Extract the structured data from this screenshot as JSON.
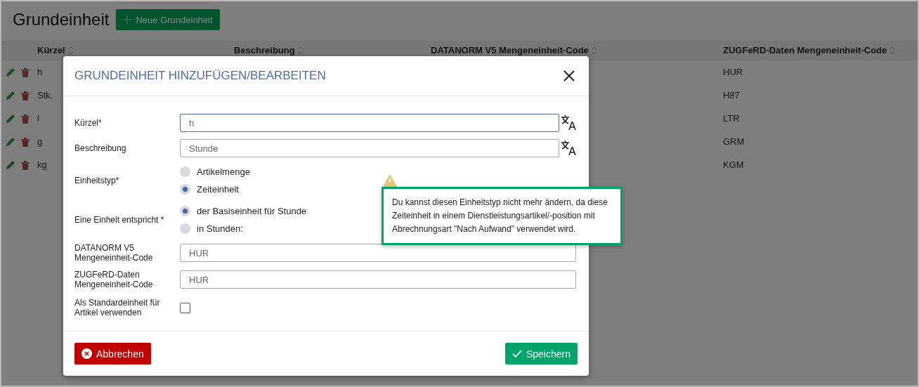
{
  "page": {
    "title": "Grundeinheit",
    "new_button": "Neue Grundeinheit"
  },
  "table": {
    "columns": [
      "Kürzel",
      "Beschreibung",
      "DATANORM V5 Mengeneinheit-Code",
      "ZUGFeRD-Daten Mengeneinheit-Code"
    ],
    "rows": [
      {
        "kuerzel": "h",
        "zugferd": "HUR"
      },
      {
        "kuerzel": "Stk.",
        "zugferd": "H87"
      },
      {
        "kuerzel": "l",
        "zugferd": "LTR"
      },
      {
        "kuerzel": "g",
        "zugferd": "GRM"
      },
      {
        "kuerzel": "kg",
        "zugferd": "KGM"
      }
    ]
  },
  "dialog": {
    "title": "GRUNDEINHEIT HINZUFÜGEN/BEARBEITEN",
    "fields": [
      {
        "kind": "input",
        "label": "Kürzel*",
        "value": "h",
        "focused": true,
        "translatable": true
      },
      {
        "kind": "input",
        "label": "Beschreibung",
        "value": "Stunde",
        "focused": false,
        "translatable": true
      },
      {
        "kind": "radio",
        "label": "Einheitstyp*",
        "options": [
          {
            "label": "Artikelmenge",
            "selected": false
          },
          {
            "label": "Zeiteinheit",
            "selected": true
          }
        ]
      },
      {
        "kind": "radio",
        "label": "Eine Einheit entspricht *",
        "options": [
          {
            "label": "der Basiseinheit für Stunde",
            "selected": true
          },
          {
            "label": "in Stunden:",
            "selected": false
          }
        ]
      },
      {
        "kind": "input",
        "label": "DATANORM V5 Mengeneinheit-Code",
        "value": "HUR",
        "focused": false,
        "translatable": false
      },
      {
        "kind": "input",
        "label": "ZUGFeRD-Daten Mengeneinheit-Code",
        "value": "HUR",
        "focused": false,
        "translatable": false
      },
      {
        "kind": "checkbox",
        "label": "Als Standardeinheit für Artikel verwenden",
        "checked": false
      }
    ],
    "tooltip": "Du kannst diesen Einheitstyp nicht mehr ändern, da diese Zeiteinheit in einem Dienstleistungsartikel/-position mit Abrechnungsart \"Nach Aufwand\" verwendet wird.",
    "cancel_button": "Abbrechen",
    "save_button": "Speichern"
  }
}
